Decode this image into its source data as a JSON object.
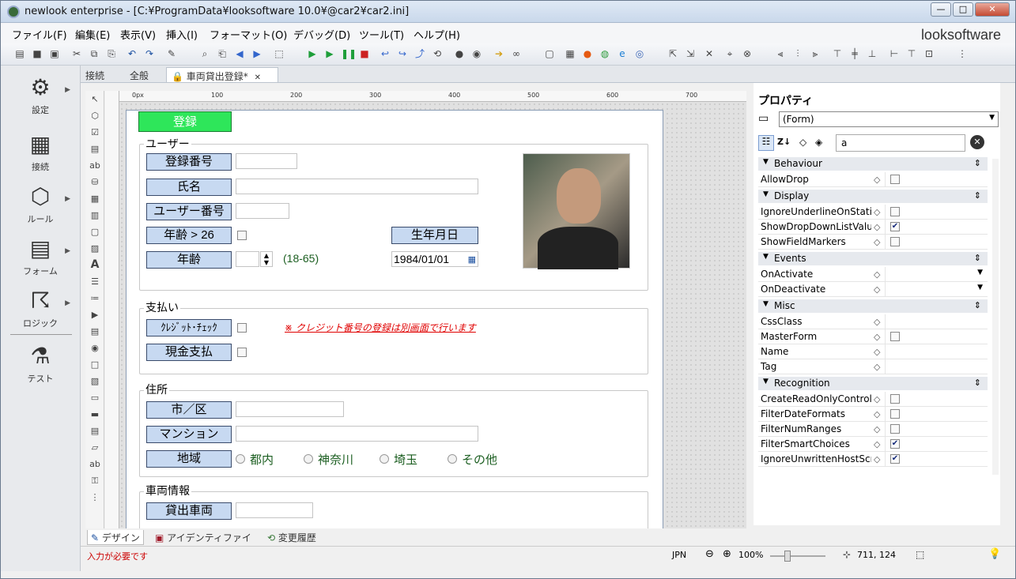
{
  "window": {
    "title": "newlook enterprise - [C:¥ProgramData¥looksoftware 10.0¥@car2¥car2.ini]",
    "brand": "looksoftware",
    "controls": {
      "minimize": "—",
      "maximize": "□",
      "close": "✕"
    }
  },
  "menu": [
    "ファイル(F)",
    "編集(E)",
    "表示(V)",
    "挿入(I)",
    "フォーマット(O)",
    "デバッグ(D)",
    "ツール(T)",
    "ヘルプ(H)"
  ],
  "left_panel": [
    {
      "label": "設定",
      "icon": "gear-icon",
      "glyph": "⚙"
    },
    {
      "label": "接続",
      "icon": "connection-icon",
      "glyph": "▦"
    },
    {
      "label": "ルール",
      "icon": "rule-icon",
      "glyph": "⬡"
    },
    {
      "label": "フォーム",
      "icon": "form-icon",
      "glyph": "▤"
    },
    {
      "label": "ロジック",
      "icon": "logic-icon",
      "glyph": "☈"
    },
    {
      "label": "テスト",
      "icon": "test-icon",
      "glyph": "⚗"
    }
  ],
  "doc_tabs": {
    "tab1": "接続",
    "tab2": "全般",
    "tab3": "車両貸出登録*",
    "close": "✕"
  },
  "ruler": {
    "h": [
      "0px",
      "100",
      "200",
      "300",
      "400",
      "500",
      "600",
      "700"
    ]
  },
  "form": {
    "register_btn": "登録",
    "user": {
      "title": "ユーザー",
      "reg_no": "登録番号",
      "name": "氏名",
      "user_no": "ユーザー番号",
      "age_gt": "年齢 > 26",
      "birthday": "生年月日",
      "age": "年齢",
      "age_hint": "(18-65)",
      "birth_value": "1984/01/01"
    },
    "payment": {
      "title": "支払い",
      "credit": "ｸﾚｼﾞｯﾄ･ﾁｪｯｸ",
      "cash": "現金支払",
      "note": "※ クレジット番号の登録は別画面で行います"
    },
    "address": {
      "title": "住所",
      "city": "市／区",
      "mansion": "マンション",
      "region": "地域",
      "options": [
        "都内",
        "神奈川",
        "埼玉",
        "その他"
      ]
    },
    "vehicle": {
      "title": "車両情報",
      "rental": "貸出車両"
    }
  },
  "properties": {
    "title": "プロパティ",
    "object": "(Form)",
    "search": "a",
    "categories": [
      {
        "name": "Behaviour",
        "rows": [
          {
            "name": "AllowDrop",
            "type": "check",
            "checked": false
          }
        ]
      },
      {
        "name": "Display",
        "rows": [
          {
            "name": "IgnoreUnderlineOnStatic",
            "type": "check",
            "checked": false
          },
          {
            "name": "ShowDropDownListValue",
            "type": "check",
            "checked": true
          },
          {
            "name": "ShowFieldMarkers",
            "type": "check",
            "checked": false
          }
        ]
      },
      {
        "name": "Events",
        "rows": [
          {
            "name": "OnActivate",
            "type": "dropdown"
          },
          {
            "name": "OnDeactivate",
            "type": "dropdown"
          }
        ]
      },
      {
        "name": "Misc",
        "rows": [
          {
            "name": "CssClass",
            "type": "text"
          },
          {
            "name": "MasterForm",
            "type": "check",
            "checked": false
          },
          {
            "name": "Name",
            "type": "text"
          },
          {
            "name": "Tag",
            "type": "text"
          }
        ]
      },
      {
        "name": "Recognition",
        "rows": [
          {
            "name": "CreateReadOnlyControls",
            "type": "check",
            "checked": false
          },
          {
            "name": "FilterDateFormats",
            "type": "check",
            "checked": false
          },
          {
            "name": "FilterNumRanges",
            "type": "check",
            "checked": false
          },
          {
            "name": "FilterSmartChoices",
            "type": "check",
            "checked": true
          },
          {
            "name": "IgnoreUnwrittenHostScreens",
            "type": "check",
            "checked": true
          }
        ]
      }
    ]
  },
  "bottom_tabs": {
    "design": "デザイン",
    "identify": "アイデンティファイ",
    "history": "変更履歴"
  },
  "status": {
    "message": "入力が必要です",
    "lang": "JPN",
    "zoom": "100%",
    "coords": "711, 124"
  }
}
